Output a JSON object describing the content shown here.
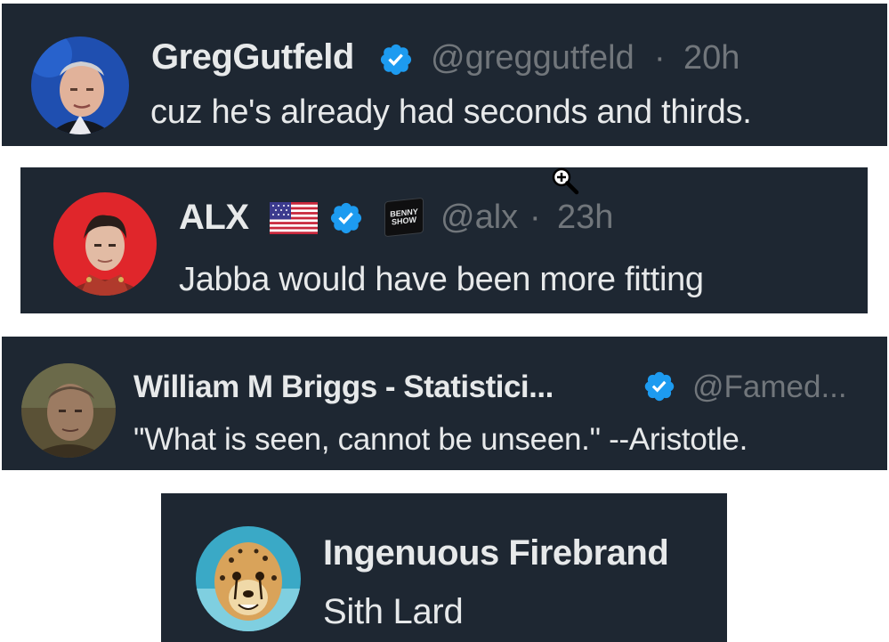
{
  "tweets": [
    {
      "name": "GregGutfeld",
      "handle": "@greggutfeld",
      "time": "20h",
      "text": "cuz he's already had seconds and thirds.",
      "verified": true,
      "avatar": "greg-gutfeld-avatar"
    },
    {
      "name": "ALX",
      "flag": "us-flag-icon",
      "affiliate_badge": "BENNY SHOW",
      "handle": "@alx",
      "time": "23h",
      "text": "Jabba would have been more fitting",
      "verified": true,
      "avatar": "alx-avatar"
    },
    {
      "name": "William M Briggs - Statistici...",
      "handle": "@Famed...",
      "text": "\"What is seen, cannot be unseen.\" --Aristotle.",
      "verified": true,
      "avatar": "william-briggs-avatar"
    },
    {
      "name": "Ingenuous Firebrand",
      "text": "Sith Lard",
      "avatar": "cheetah-avatar"
    }
  ],
  "separator": "·",
  "colors": {
    "card_bg": "#1e2732",
    "text": "#e7e9ea",
    "muted": "#71767b",
    "verified_blue": "#1d9bf0"
  }
}
